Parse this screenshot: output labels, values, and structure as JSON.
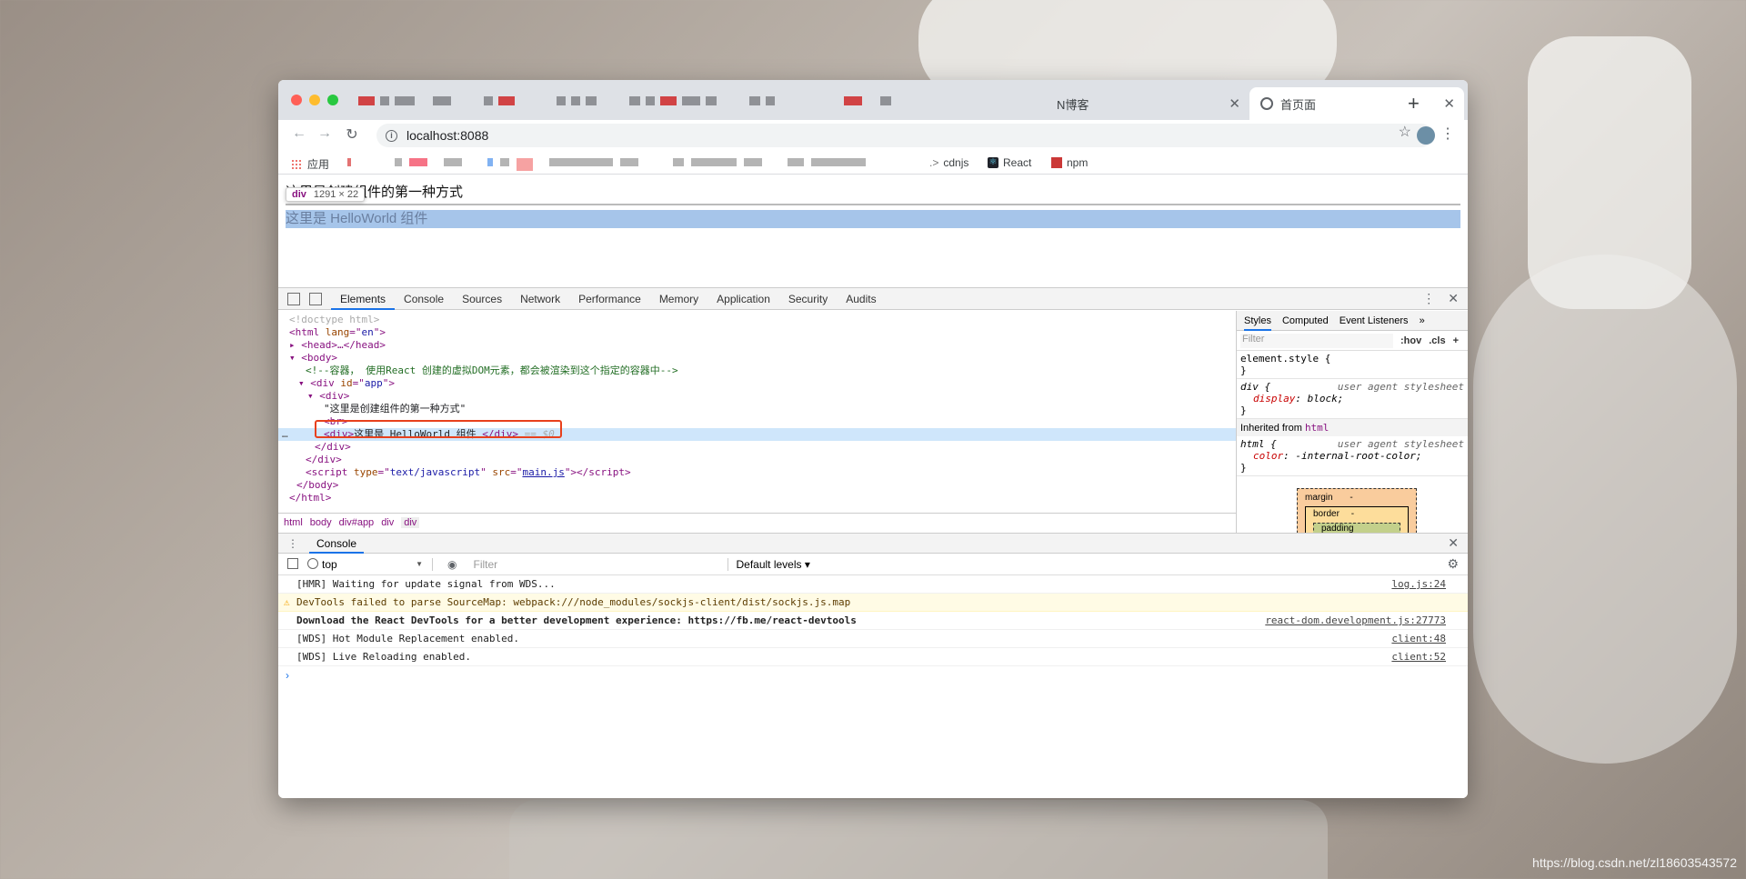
{
  "browser": {
    "tabs": [
      {
        "label": "N博客",
        "active": false
      },
      {
        "label": "首页面",
        "active": true
      }
    ],
    "url": "localhost:8088",
    "bookmarks": {
      "apps_label": "应用",
      "items": [
        {
          "label": "cdnjs",
          "prefix": ".>"
        },
        {
          "label": "React"
        },
        {
          "label": "npm"
        }
      ]
    }
  },
  "page": {
    "heading": "这里是创建组件的第一种方式",
    "highlight_text": "这里是 HelloWorld 组件",
    "tooltip_tag": "div",
    "tooltip_size": "1291 × 22"
  },
  "devtools": {
    "tabs": [
      "Elements",
      "Console",
      "Sources",
      "Network",
      "Performance",
      "Memory",
      "Application",
      "Security",
      "Audits"
    ],
    "active_tab": "Elements",
    "dom": {
      "doctype": "<!doctype html>",
      "comment": "<!--容器， 使用React 创建的虚拟DOM元素，都会被渲染到这个指定的容器中-->",
      "app_id": "app",
      "text_node": "\"这里是创建组件的第一种方式\"",
      "selected_text": "这里是 HelloWorld 组件 ",
      "selected_suffix": "== $0",
      "script_type": "text/javascript",
      "script_src": "main.js",
      "lang": "en"
    },
    "breadcrumbs": [
      "html",
      "body",
      "div#app",
      "div",
      "div"
    ],
    "styles": {
      "tabs": [
        "Styles",
        "Computed",
        "Event Listeners",
        "»"
      ],
      "filter_placeholder": "Filter",
      "hov": ":hov",
      "cls": ".cls",
      "element_style": "element.style {",
      "rule1_selector": "div {",
      "rule1_source": "user agent stylesheet",
      "rule1_prop": "display",
      "rule1_val": "block;",
      "inherited_label": "Inherited from",
      "inherited_tag": "html",
      "rule2_selector": "html {",
      "rule2_prop": "color",
      "rule2_val": "-internal-root-color;",
      "box_margin": "margin",
      "box_border": "border",
      "box_padding": "padding",
      "dash": "-"
    },
    "console": {
      "title": "Console",
      "context": "top",
      "filter_placeholder": "Filter",
      "levels": "Default levels ▾",
      "messages": [
        {
          "text": "[HMR] Waiting for update signal from WDS...",
          "source": "log.js:24",
          "type": "log"
        },
        {
          "text": "DevTools failed to parse SourceMap: webpack:///node_modules/sockjs-client/dist/sockjs.js.map",
          "source": "",
          "type": "warn"
        },
        {
          "text": "Download the React DevTools for a better development experience: https://fb.me/react-devtools",
          "source": "react-dom.development.js:27773",
          "type": "bold"
        },
        {
          "text": "[WDS] Hot Module Replacement enabled.",
          "source": "client:48",
          "type": "log"
        },
        {
          "text": "[WDS] Live Reloading enabled.",
          "source": "client:52",
          "type": "log"
        }
      ],
      "prompt": "›"
    }
  },
  "watermark": "https://blog.csdn.net/zl18603543572"
}
